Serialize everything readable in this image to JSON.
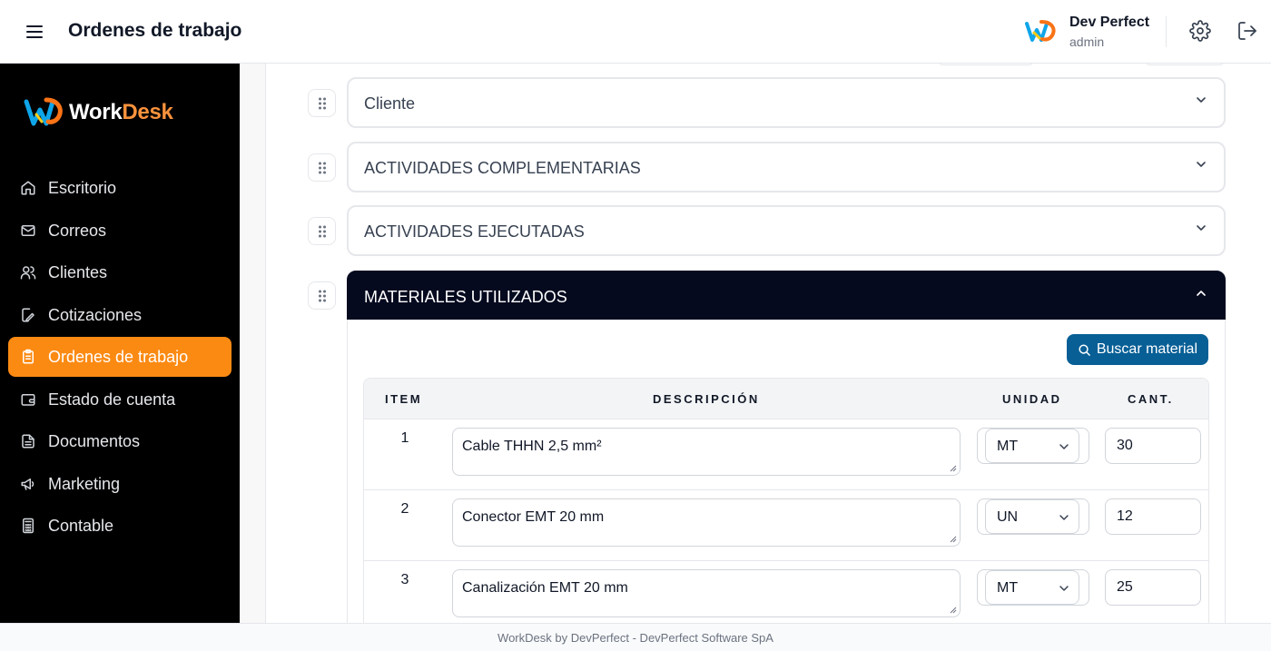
{
  "header": {
    "title": "Ordenes de trabajo",
    "user_name": "Dev Perfect",
    "user_role": "admin",
    "icons": [
      "menu-icon",
      "user-logo-icon",
      "gear-icon",
      "logout-icon"
    ]
  },
  "sidebar": {
    "brand": {
      "part1": "Work",
      "part2": "Desk"
    },
    "items": [
      {
        "label": "Escritorio",
        "icon": "home-icon"
      },
      {
        "label": "Correos",
        "icon": "mail-icon"
      },
      {
        "label": "Clientes",
        "icon": "users-icon"
      },
      {
        "label": "Cotizaciones",
        "icon": "edit-document-icon"
      },
      {
        "label": "Ordenes de trabajo",
        "icon": "clipboard-icon",
        "active": true
      },
      {
        "label": "Estado de cuenta",
        "icon": "wallet-icon"
      },
      {
        "label": "Documentos",
        "icon": "document-icon"
      },
      {
        "label": "Marketing",
        "icon": "megaphone-icon"
      },
      {
        "label": "Contable",
        "icon": "calculator-icon"
      }
    ]
  },
  "sections": [
    {
      "title": "Cliente",
      "open": false
    },
    {
      "title": "ACTIVIDADES COMPLEMENTARIAS",
      "open": false
    },
    {
      "title": "ACTIVIDADES EJECUTADAS",
      "open": false
    },
    {
      "title": "MATERIALES UTILIZADOS",
      "open": true
    }
  ],
  "materials": {
    "search_button": "Buscar material",
    "columns": [
      "ITEM",
      "DESCRIPCIÓN",
      "UNIDAD",
      "CANT."
    ],
    "rows": [
      {
        "item": "1",
        "description": "Cable THHN 2,5 mm²",
        "unit": "MT",
        "qty": "30"
      },
      {
        "item": "2",
        "description": "Conector EMT 20 mm",
        "unit": "UN",
        "qty": "12"
      },
      {
        "item": "3",
        "description": "Canalización EMT 20 mm",
        "unit": "MT",
        "qty": "25"
      }
    ]
  },
  "footer": {
    "text": "WorkDesk by DevPerfect - DevPerfect Software SpA"
  },
  "colors": {
    "accent": "#fb8a13",
    "dark_header": "#050a1f",
    "button_blue": "#075f96"
  }
}
